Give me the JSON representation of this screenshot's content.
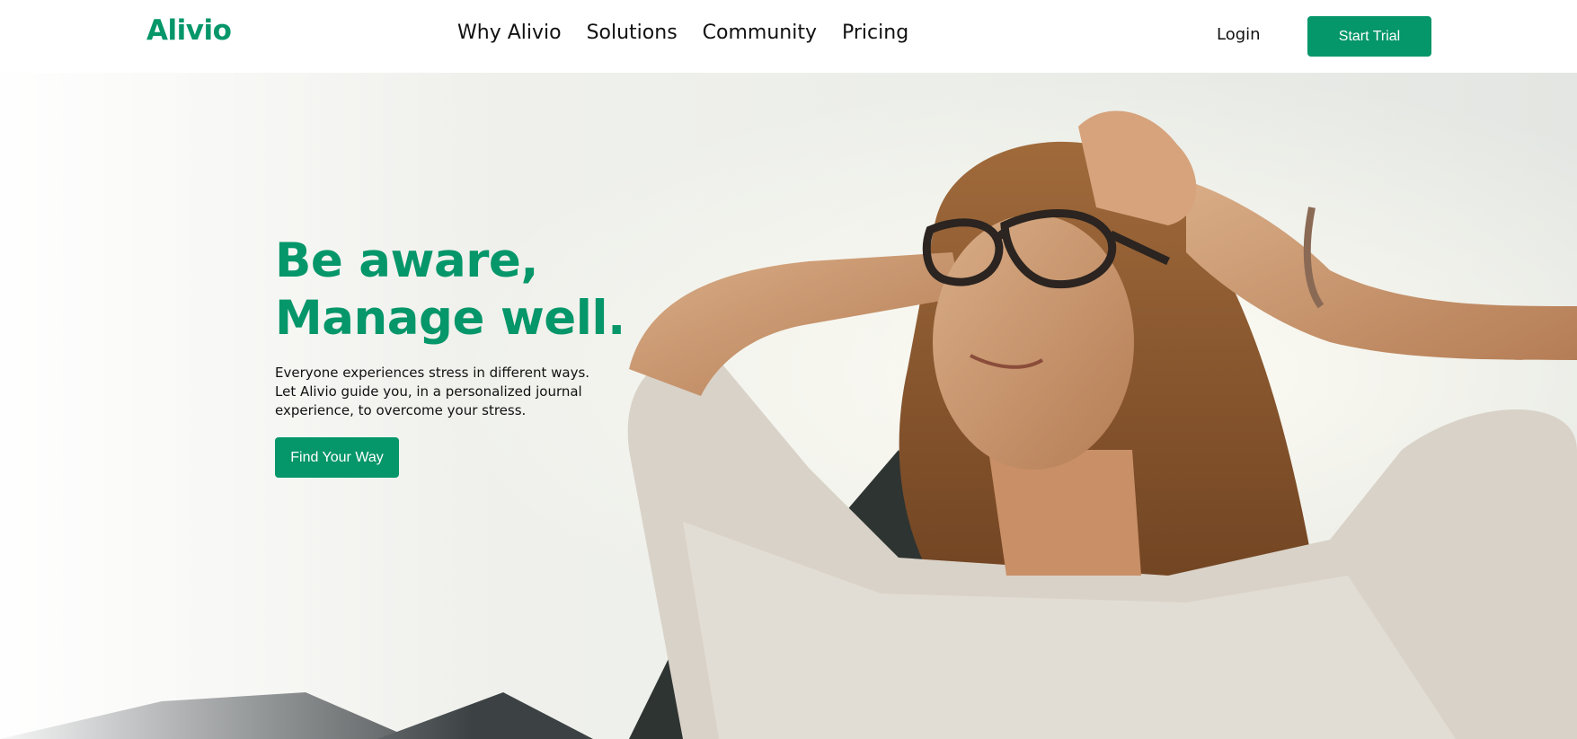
{
  "theme": {
    "accent": "#059669",
    "text": "#111111",
    "background": "#ffffff"
  },
  "header": {
    "logo": "Alivio",
    "nav": [
      "Why Alivio",
      "Solutions",
      "Community",
      "Pricing"
    ],
    "login_label": "Login",
    "start_trial_label": "Start Trial"
  },
  "hero": {
    "headline": [
      "Be aware,",
      "Manage well."
    ],
    "description": [
      "Everyone experiences stress in different ways.",
      "Let Alivio guide you, in a personalized journal",
      "experience, to overcome your stress."
    ],
    "cta_label": "Find Your Way"
  }
}
